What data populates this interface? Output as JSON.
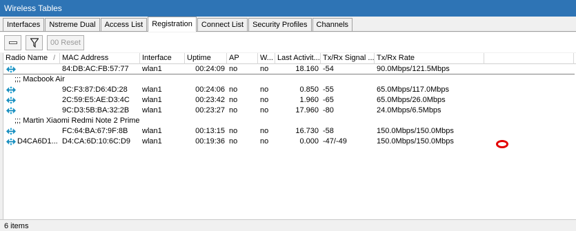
{
  "window": {
    "title": "Wireless Tables"
  },
  "tabs": [
    {
      "label": "Interfaces",
      "active": false
    },
    {
      "label": "Nstreme Dual",
      "active": false
    },
    {
      "label": "Access List",
      "active": false
    },
    {
      "label": "Registration",
      "active": true
    },
    {
      "label": "Connect List",
      "active": false
    },
    {
      "label": "Security Profiles",
      "active": false
    },
    {
      "label": "Channels",
      "active": false
    }
  ],
  "toolbar": {
    "remove_icon": "minus-icon",
    "filter_icon": "filter-icon",
    "reset_label": "Reset",
    "reset_prefix": "00"
  },
  "columns": [
    "Radio Name",
    "MAC Address",
    "Interface",
    "Uptime",
    "AP",
    "W...",
    "Last Activit...",
    "Tx/Rx Signal ...",
    "Tx/Rx Rate",
    ""
  ],
  "sort_indicator": "/",
  "rows": [
    {
      "kind": "entry",
      "radio_name": "",
      "mac": "84:DB:AC:FB:57:77",
      "interface": "wlan1",
      "uptime": "00:24:09",
      "ap": "no",
      "wds": "no",
      "last_activity": "18.160",
      "signal": "-54",
      "rate": "90.0Mbps/121.5Mbps"
    },
    {
      "kind": "comment",
      "text": ";;; Macbook Air"
    },
    {
      "kind": "entry",
      "radio_name": "",
      "mac": "9C:F3:87:D6:4D:28",
      "interface": "wlan1",
      "uptime": "00:24:06",
      "ap": "no",
      "wds": "no",
      "last_activity": "0.850",
      "signal": "-55",
      "rate": "65.0Mbps/117.0Mbps"
    },
    {
      "kind": "entry",
      "radio_name": "",
      "mac": "2C:59:E5:AE:D3:4C",
      "interface": "wlan1",
      "uptime": "00:23:42",
      "ap": "no",
      "wds": "no",
      "last_activity": "1.960",
      "signal": "-65",
      "rate": "65.0Mbps/26.0Mbps"
    },
    {
      "kind": "entry",
      "radio_name": "",
      "mac": "9C:D3:5B:BA:32:2B",
      "interface": "wlan1",
      "uptime": "00:23:27",
      "ap": "no",
      "wds": "no",
      "last_activity": "17.960",
      "signal": "-80",
      "rate": "24.0Mbps/6.5Mbps"
    },
    {
      "kind": "comment",
      "text": ";;; Martin Xiaomi Redmi Note 2 Prime"
    },
    {
      "kind": "entry",
      "radio_name": "",
      "mac": "FC:64:BA:67:9F:8B",
      "interface": "wlan1",
      "uptime": "00:13:15",
      "ap": "no",
      "wds": "no",
      "last_activity": "16.730",
      "signal": "-58",
      "rate": "150.0Mbps/150.0Mbps"
    },
    {
      "kind": "entry",
      "radio_name": "D4CA6D1...",
      "mac": "D4:CA:6D:10:6C:D9",
      "interface": "wlan1",
      "uptime": "00:19:36",
      "ap": "no",
      "wds": "no",
      "last_activity": "0.000",
      "signal": "-47/-49",
      "rate": "150.0Mbps/150.0Mbps"
    }
  ],
  "status": {
    "items_text": "6 items"
  },
  "colors": {
    "titlebar": "#2e74b5",
    "annotation": "#e30000",
    "icon": "#1a8fbf"
  }
}
